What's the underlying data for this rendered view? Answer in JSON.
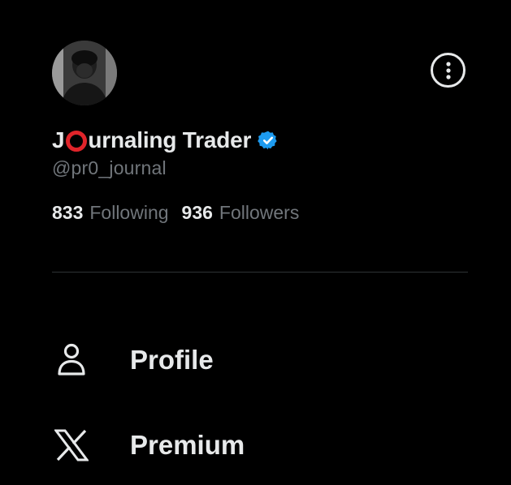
{
  "account": {
    "display_name_prefix": "J",
    "display_name_rest": "urnaling Trader",
    "handle": "@pr0_journal",
    "verified": true,
    "verified_color": "#1d9bf0",
    "accent_circle_color": "#e0242a"
  },
  "stats": {
    "following_count": "833",
    "following_label": "Following",
    "followers_count": "936",
    "followers_label": "Followers"
  },
  "menu": {
    "more_icon": "more-circle-icon",
    "items": [
      {
        "label": "Profile",
        "icon": "person-icon"
      },
      {
        "label": "Premium",
        "icon": "x-logo-icon"
      }
    ]
  }
}
